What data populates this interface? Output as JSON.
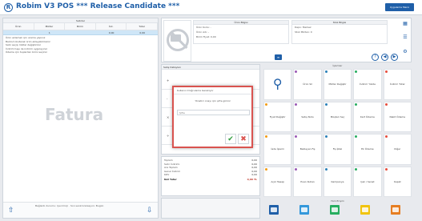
{
  "app": {
    "title": "Robim V3 POS *** Release Candidate ***",
    "logo": "R",
    "top_button": "Uygulama Menü"
  },
  "left_panel": {
    "header_label": "Satırlar",
    "columns": [
      "Ürün",
      "Miktar",
      "Birim",
      "İnd.",
      "Tutar"
    ],
    "selected_row": [
      "",
      "1",
      "",
      "0.00",
      "0.00"
    ],
    "notes": [
      "Ürün eklemek için arama yapınız",
      "Barkod okutarak ürün ekleyebilirsiniz",
      "Satır seçip miktar değiştiriniz",
      "İndirim tuşu ile indirim uygulayınız",
      "Ödeme için tuşlardan birini seçiniz"
    ],
    "watermark": "Fatura",
    "footer_text": "Bağlantı durumu: Çevrimiçi · Son senkronizasyon: Bugün",
    "arrow_left": "⇧",
    "arrow_right": "⇩"
  },
  "product": {
    "grid1_title": "Ürün Bilgisi",
    "grid1_rows": [
      "Ürün Kodu:  -",
      "Ürün Adı:  -",
      "Birim Fiyat:  0,00"
    ],
    "grid2_title": "Stok Bilgisi",
    "grid2_rows": [
      "Depo:  Merkez",
      "Stok Miktarı: 0"
    ],
    "icons": [
      "grid-icon",
      "list-icon",
      "settings-icon"
    ],
    "mini_button": "≡",
    "nav": [
      "?",
      "◀",
      "▶"
    ]
  },
  "cart": {
    "header": "Satış Detayları",
    "markers": [
      "+",
      "-",
      "×",
      "÷"
    ]
  },
  "totals": {
    "rows": [
      {
        "label": "Toplam",
        "value": "0,00"
      },
      {
        "label": "Satır İndirimi",
        "value": "0,00"
      },
      {
        "label": "Ara Toplam",
        "value": "0,00"
      },
      {
        "label": "Genel İndirim",
        "value": "0,00"
      },
      {
        "label": "KDV",
        "value": "0,00"
      }
    ],
    "net_label": "Net Tutar",
    "net_value": "0,00 TL"
  },
  "keypad": {
    "header": "İşlemler",
    "keys": [
      "search",
      "Ürün Sil",
      "Miktar Değiştir",
      "İndirim Yüzde",
      "İndirim Tutar",
      "Fiyat Değiştir",
      "Satış Notu",
      "Müşteri Seç",
      "Kart Ödeme",
      "Nakit Ödeme",
      "İade İşlemi",
      "Bekleyen Fiş",
      "Fiş İptal",
      "Ek Ödeme",
      "Diğer",
      "Açık Hesap",
      "Puan Kullan",
      "Kampanya",
      "Çek / Senet",
      "Kapat"
    ],
    "dot_colors": [
      "#f39c12",
      "#9b59b6",
      "#2980b9",
      "#27ae60",
      "#e74c3c"
    ]
  },
  "tiles": {
    "header": "Hızlı Erişim",
    "colors": [
      "#1f5fa8",
      "#3498db",
      "#27ae60",
      "#f1c40f",
      "#e67e22"
    ]
  },
  "modal": {
    "title": "Kullanıcı Doğrulama Gerekiyor",
    "message": "Yönetici onayı için şifre giriniz",
    "input_value": "Şifre",
    "ok": "✔",
    "cancel": "✖"
  }
}
